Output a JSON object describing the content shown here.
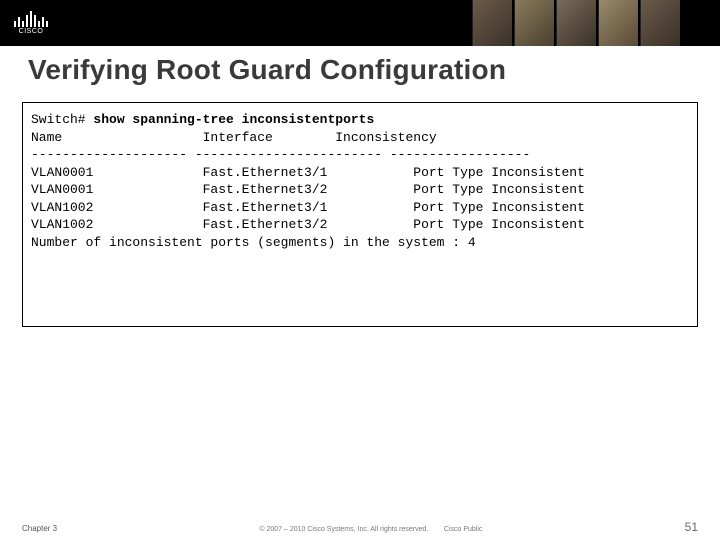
{
  "header": {
    "logo_text": "CISCO"
  },
  "title": "Verifying Root Guard Configuration",
  "terminal": {
    "prompt": "Switch#",
    "command": "show spanning-tree inconsistentports",
    "col_headers": [
      "Name",
      "Interface",
      "Inconsistency"
    ],
    "separators": [
      "--------------------",
      "------------------------",
      "------------------"
    ],
    "rows": [
      {
        "name": "VLAN0001",
        "interface": "Fast.Ethernet3/1",
        "inconsistency": "Port Type Inconsistent"
      },
      {
        "name": "VLAN0001",
        "interface": "Fast.Ethernet3/2",
        "inconsistency": "Port Type Inconsistent"
      },
      {
        "name": "VLAN1002",
        "interface": "Fast.Ethernet3/1",
        "inconsistency": "Port Type Inconsistent"
      },
      {
        "name": "VLAN1002",
        "interface": "Fast.Ethernet3/2",
        "inconsistency": "Port Type Inconsistent"
      }
    ],
    "summary": "Number of inconsistent ports (segments) in the system : 4"
  },
  "footer": {
    "chapter": "Chapter 3",
    "copyright": "© 2007 – 2010  Cisco Systems, Inc. All rights reserved.",
    "classification": "Cisco Public",
    "page": "51"
  }
}
